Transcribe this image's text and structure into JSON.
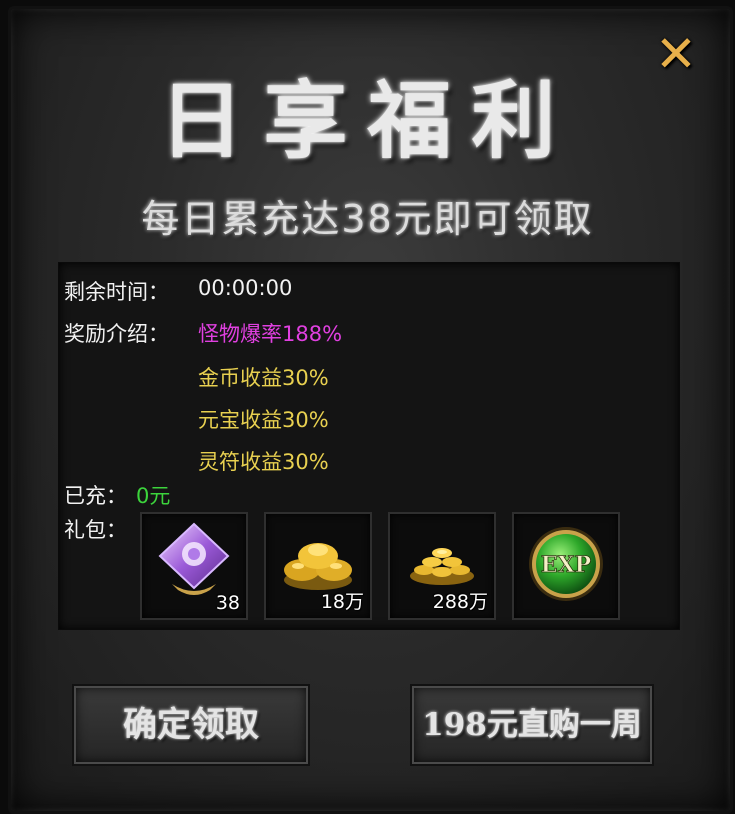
{
  "title": "日享福利",
  "subtitle": "每日累充达38元即可领取",
  "info": {
    "time_label": "剩余时间：",
    "time_value": "00:00:00",
    "reward_label": "奖励介绍：",
    "rewards": [
      "怪物爆率188%",
      "金币收益30%",
      "元宝收益30%",
      "灵符收益30%"
    ],
    "charged_label": "已充：",
    "charged_value": "0元",
    "gift_label": "礼包："
  },
  "gifts": [
    {
      "icon": "purple-crystal-icon",
      "count": "38"
    },
    {
      "icon": "gold-ingot-pile-icon",
      "count": "18万"
    },
    {
      "icon": "gold-coins-icon",
      "count": "288万"
    },
    {
      "icon": "exp-orb-icon",
      "count": ""
    }
  ],
  "buttons": {
    "claim": "确定领取",
    "buy_week": "198元直购一周"
  },
  "colors": {
    "reward_highlight": "#e040e0",
    "reward_normal": "#e8d050",
    "charged_value": "#3cd43c",
    "close_accent": "#e8b04a"
  }
}
